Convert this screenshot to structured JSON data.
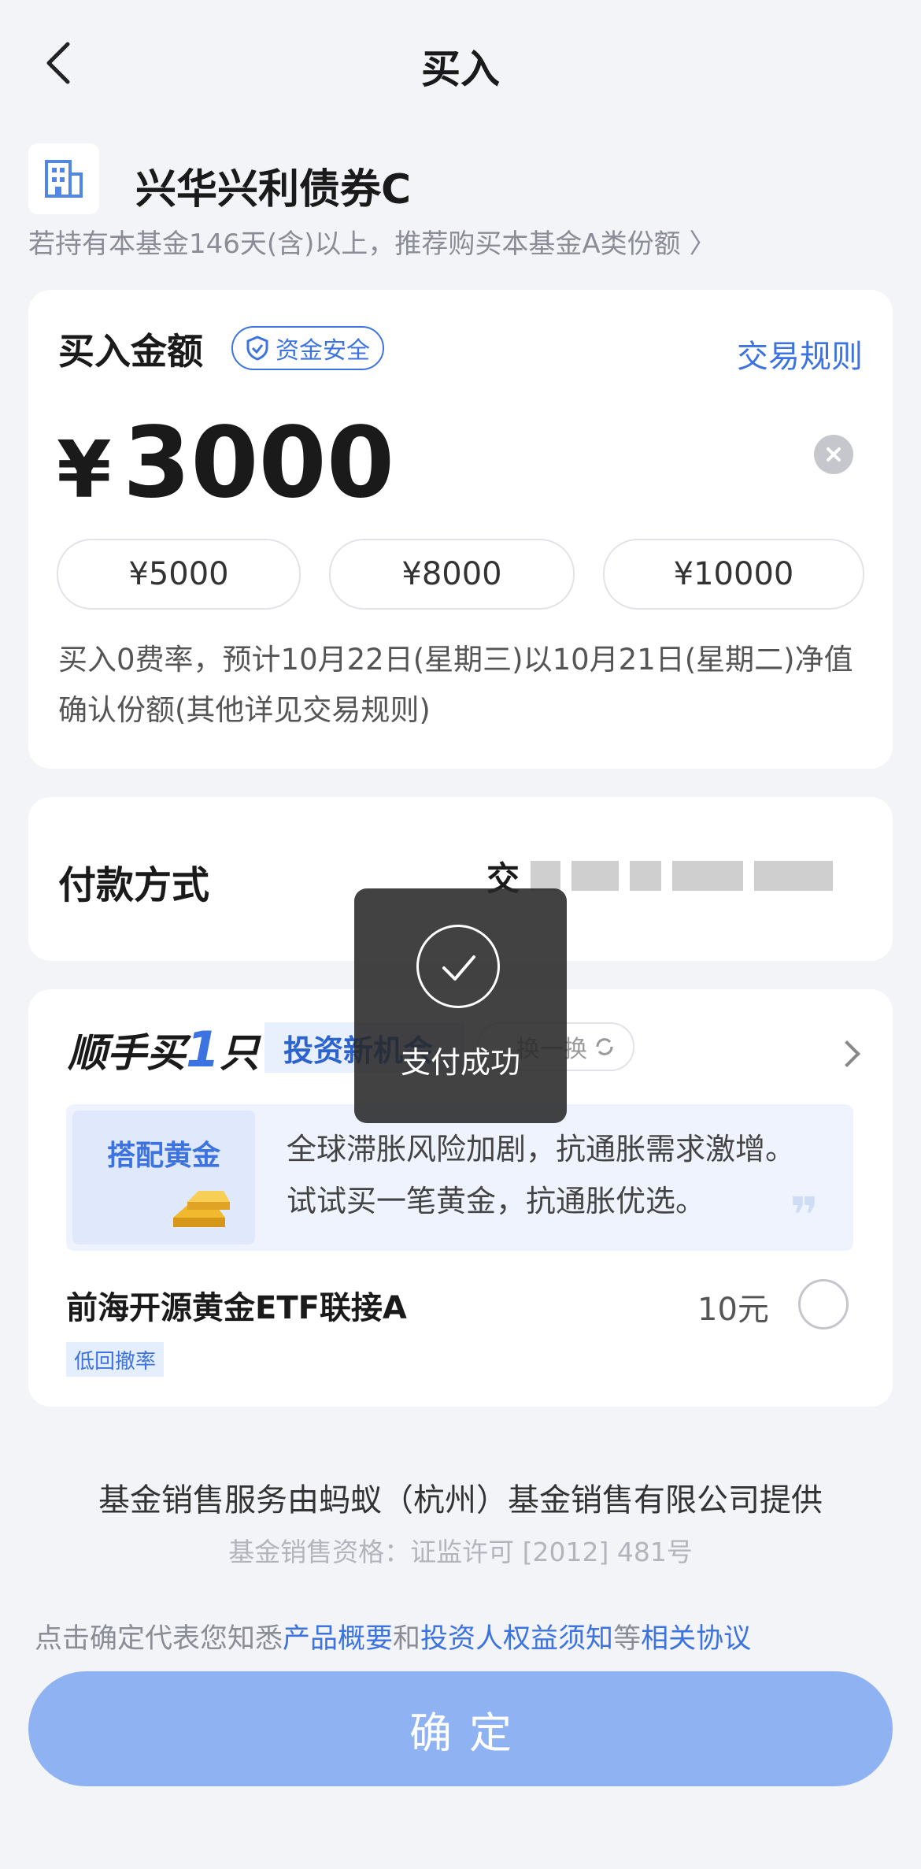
{
  "nav": {
    "title": "买入"
  },
  "fund": {
    "name": "兴华兴利债券C",
    "tip": "若持有本基金146天(含)以上，推荐购买本基金A类份额 〉"
  },
  "amount_card": {
    "label": "买入金额",
    "safe_badge": "资金安全",
    "rules_link": "交易规则",
    "currency": "¥",
    "amount": "3000",
    "quick": [
      "¥5000",
      "¥8000",
      "¥10000"
    ],
    "fee_text": "买入0费率，预计10月22日(星期三)以10月21日(星期二)净值确认份额(其他详见交易规则)"
  },
  "payment": {
    "label": "付款方式",
    "value_visible": "交"
  },
  "shunshou": {
    "title_a": "顺手买",
    "title_num": "1",
    "title_b": "只",
    "tag": "投资新机会",
    "swap": "换一换",
    "promo_box_title": "搭配黄金",
    "promo_line1": "全球滞胀风险加剧，抗通胀需求激增。",
    "promo_line2": "试试买一笔黄金，抗通胀优选。",
    "quote_mark": "❞",
    "product_name": "前海开源黄金ETF联接A",
    "product_price": "10元",
    "product_tag": "低回撤率"
  },
  "footer": {
    "provider": "基金销售服务由蚂蚁（杭州）基金销售有限公司提供",
    "license": "基金销售资格：证监许可 [2012] 481号",
    "agree_prefix": "点击确定代表您知悉",
    "agree_link1": "产品概要",
    "agree_and": "和",
    "agree_link2": "投资人权益须知",
    "agree_etc": "等",
    "agree_link3": "相关协议",
    "confirm": "确定"
  },
  "toast": {
    "text": "支付成功"
  },
  "colors": {
    "accent": "#3c73e0",
    "button": "#8fb2f3",
    "background": "#f3f4f8"
  }
}
